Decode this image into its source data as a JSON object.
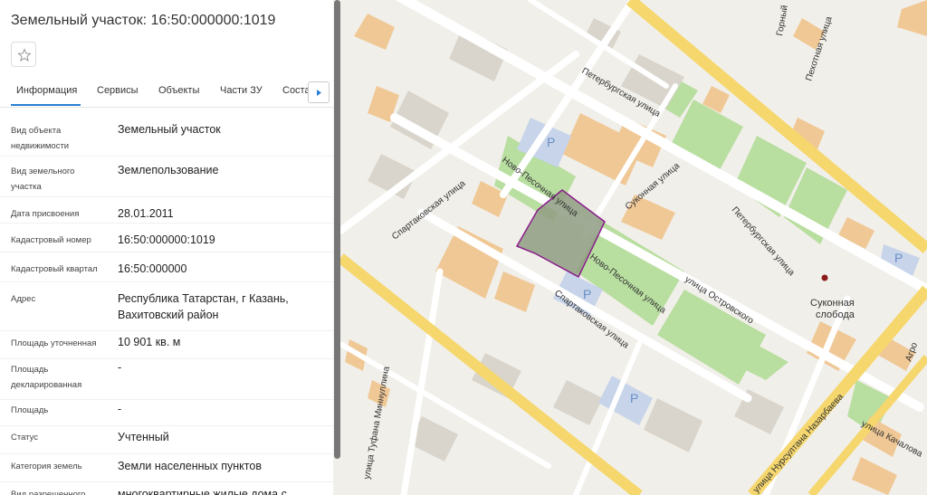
{
  "panel": {
    "title": "Земельный участок: 16:50:000000:1019",
    "tabs": [
      {
        "label": "Информация"
      },
      {
        "label": "Сервисы"
      },
      {
        "label": "Объекты"
      },
      {
        "label": "Части ЗУ"
      },
      {
        "label": "Соста"
      }
    ],
    "rows": [
      {
        "label": "Вид объекта недвижимости",
        "value": "Земельный участок"
      },
      {
        "label": "Вид земельного участка",
        "value": "Землепользование"
      },
      {
        "label": "Дата присвоения",
        "value": "28.01.2011"
      },
      {
        "label": "Кадастровый номер",
        "value": "16:50:000000:1019"
      },
      {
        "label": "Кадастровый квартал",
        "value": "16:50:000000"
      },
      {
        "label": "Адрес",
        "value": "Республика Татарстан, г Казань, Вахитовский район"
      },
      {
        "label": "Площадь уточненная",
        "value": "10 901 кв. м"
      },
      {
        "label": "Площадь декларированная",
        "value": "-"
      },
      {
        "label": "Площадь",
        "value": "-"
      },
      {
        "label": "Статус",
        "value": "Учтенный"
      },
      {
        "label": "Категория земель",
        "value": "Земли населенных пунктов"
      },
      {
        "label": "Вид разрешенного",
        "value": "многоквартирные жилые дома с"
      }
    ]
  },
  "map": {
    "streets": {
      "spartakovskaya_top": "Спартаковская улица",
      "novo_pesochnaya_top": "Ново-Песочная улица",
      "petersburgskaya_top": "Петербургская улица",
      "sukonnaya": "Суконная улица",
      "petersburgskaya_right": "Петербургская улица",
      "novo_pesochnaya_bottom": "Ново-Песочная улица",
      "spartakovskaya_bottom": "Спартаковская улица",
      "ostrovskogo": "улица Островского",
      "minnullina": "улица Туфана Миннуллина",
      "nazarbaeva": "улица Нурсултана Назарбаева",
      "kachalova": "улица Качалова",
      "gorny": "Горный",
      "pekhotnaya": "Пехотная улица",
      "agro": "Агро"
    },
    "poi": {
      "sukonnaya_sloboda": "Суконная слобода"
    },
    "parking_symbol": "P",
    "colors": {
      "parcel_fill": "#8f9c83",
      "parcel_stroke": "#8b1d8c",
      "building": "#f0c896",
      "park": "#b8dea0",
      "main_road": "#f5d76e"
    }
  }
}
